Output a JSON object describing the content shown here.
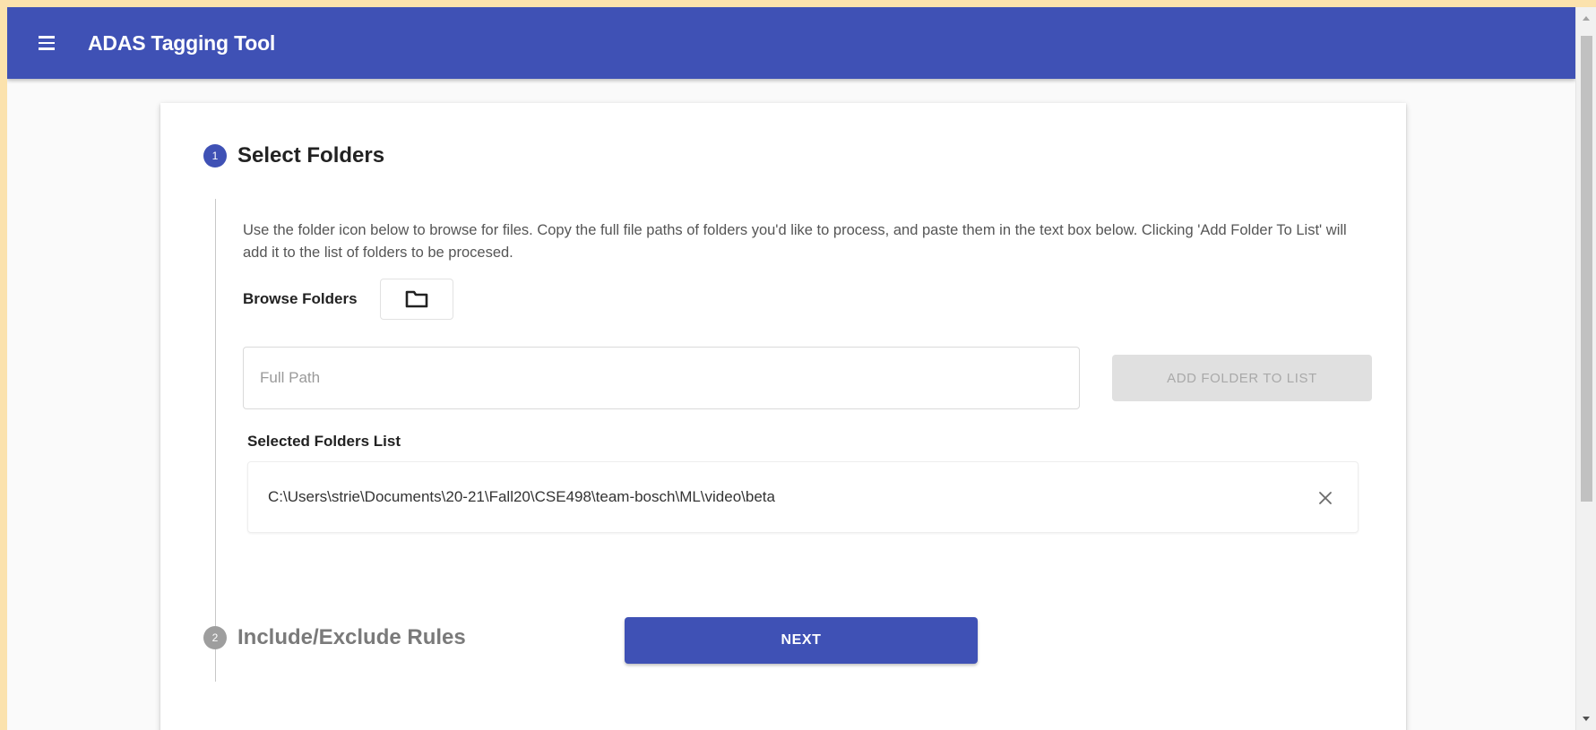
{
  "appbar": {
    "title": "ADAS Tagging Tool",
    "menu_icon": "hamburger-menu-icon",
    "color": "#3f51b5"
  },
  "steps": [
    {
      "number": "1",
      "label": "Select Folders",
      "active": true,
      "description": "Use the folder icon below to browse for files. Copy the full file paths of folders you'd like to process, and paste them in the text box below. Clicking 'Add Folder To List' will add it to the list of folders to be procesed.",
      "browse_label": "Browse Folders",
      "browse_icon": "folder-icon",
      "path_input": {
        "value": "",
        "placeholder": "Full Path"
      },
      "add_button_label": "ADD FOLDER TO LIST",
      "list_title": "Selected Folders List",
      "folders": [
        {
          "path": "C:\\Users\\strie\\Documents\\20-21\\Fall20\\CSE498\\team-bosch\\ML\\video\\beta",
          "remove_icon": "close-icon"
        }
      ],
      "next_button_label": "NEXT"
    },
    {
      "number": "2",
      "label": "Include/Exclude Rules",
      "active": false
    }
  ],
  "colors": {
    "primary": "#3f51b5",
    "disabled_button_bg": "#e0e0e0",
    "disabled_button_text": "#a9a9a9"
  }
}
